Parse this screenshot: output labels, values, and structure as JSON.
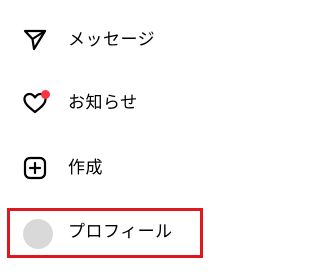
{
  "nav": {
    "items": [
      {
        "id": "messages",
        "label": "メッセージ",
        "icon": "paper-plane-icon"
      },
      {
        "id": "notifications",
        "label": "お知らせ",
        "icon": "heart-icon",
        "has_badge": true
      },
      {
        "id": "create",
        "label": "作成",
        "icon": "plus-square-icon"
      },
      {
        "id": "profile",
        "label": "プロフィール",
        "icon": "avatar",
        "highlighted": true
      }
    ]
  },
  "colors": {
    "text": "#000000",
    "badge": "#ff3040",
    "avatar_placeholder": "#d9d9d9",
    "highlight_border": "#e0171e"
  }
}
